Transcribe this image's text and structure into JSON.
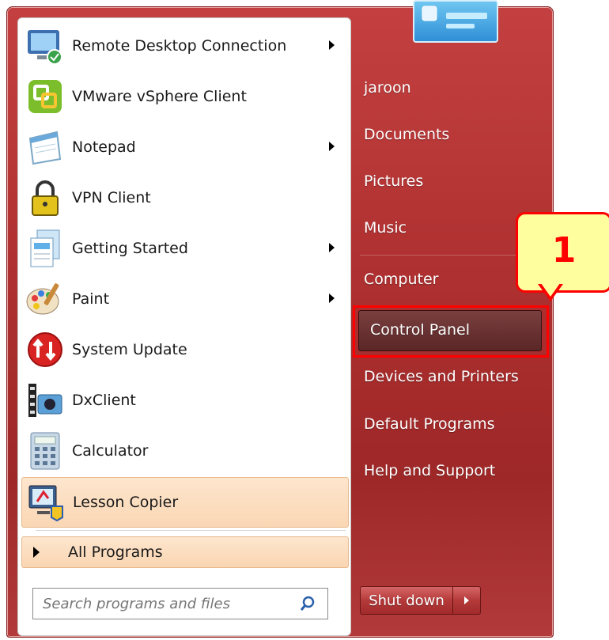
{
  "programs": [
    {
      "label": "Remote Desktop Connection",
      "icon": "remote-desktop-icon",
      "has_arrow": true
    },
    {
      "label": "VMware vSphere Client",
      "icon": "vmware-icon",
      "has_arrow": false
    },
    {
      "label": "Notepad",
      "icon": "notepad-icon",
      "has_arrow": true
    },
    {
      "label": "VPN Client",
      "icon": "lock-icon",
      "has_arrow": false
    },
    {
      "label": "Getting Started",
      "icon": "getting-started-icon",
      "has_arrow": true
    },
    {
      "label": "Paint",
      "icon": "paint-palette-icon",
      "has_arrow": true
    },
    {
      "label": "System Update",
      "icon": "system-update-icon",
      "has_arrow": false
    },
    {
      "label": "DxClient",
      "icon": "dxclient-icon",
      "has_arrow": false
    },
    {
      "label": "Calculator",
      "icon": "calculator-icon",
      "has_arrow": false
    },
    {
      "label": "Lesson Copier",
      "icon": "lesson-copier-icon",
      "has_arrow": false
    }
  ],
  "all_programs": "All Programs",
  "search": {
    "placeholder": "Search programs and files"
  },
  "right_items": [
    {
      "label": "jaroon"
    },
    {
      "label": "Documents"
    },
    {
      "label": "Pictures"
    },
    {
      "label": "Music"
    },
    {
      "label": "Computer"
    },
    {
      "label": "Control Panel"
    },
    {
      "label": "Devices and Printers"
    },
    {
      "label": "Default Programs"
    },
    {
      "label": "Help and Support"
    }
  ],
  "shutdown": {
    "label": "Shut down"
  },
  "callout": {
    "number": "1"
  },
  "colors": {
    "accent_frame": "#ff0000",
    "callout_fill": "#fffe9f",
    "menu_red": "#b03131"
  }
}
